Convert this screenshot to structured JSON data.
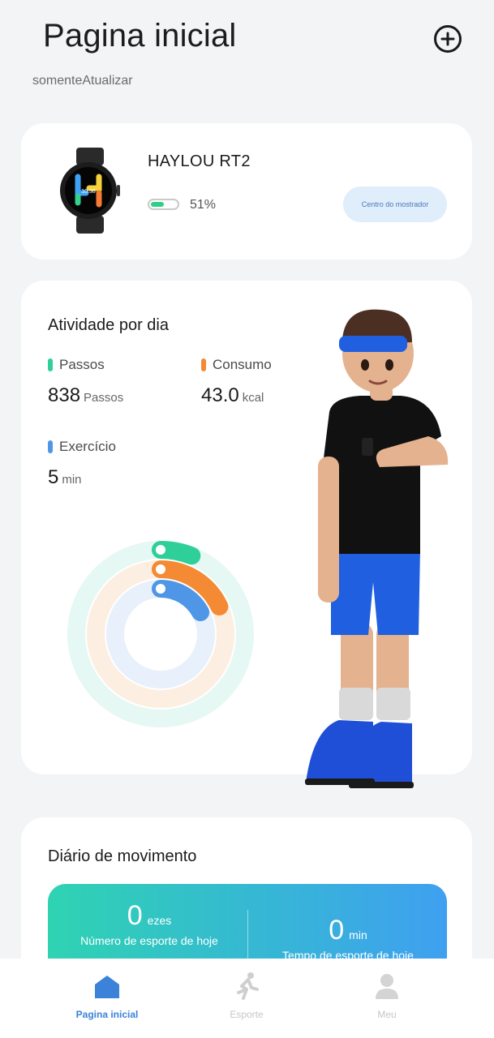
{
  "header": {
    "title": "Pagina inicial",
    "subtitle": "somenteAtualizar",
    "add_icon": "plus-circle-icon"
  },
  "device": {
    "name": "HAYLOU RT2",
    "battery_text": "51%",
    "battery_level": 0.51,
    "dial_button_label": "Centro do mostrador",
    "watch_time": "10:38"
  },
  "activity": {
    "title": "Atividade por dia",
    "steps": {
      "label": "Passos",
      "value": "838",
      "unit": "Passos",
      "color": "#2fcf9a"
    },
    "consumption": {
      "label": "Consumo",
      "value": "43.0",
      "unit": "kcal",
      "color": "#f48a33"
    },
    "exercise": {
      "label": "Exercício",
      "value": "5",
      "unit": "min",
      "color": "#4f97e6"
    },
    "rings": [
      {
        "name": "steps",
        "icon": "shoe-icon",
        "color": "#2fcf9a",
        "track": "#e6f8f3",
        "progress": 0.06
      },
      {
        "name": "consumption",
        "icon": "flame-icon",
        "color": "#f48a33",
        "track": "#fdeee2",
        "progress": 0.18
      },
      {
        "name": "exercise",
        "icon": "clock-icon",
        "color": "#4f97e6",
        "track": "#e7f0fb",
        "progress": 0.17
      }
    ]
  },
  "diary": {
    "title": "Diário de movimento",
    "sports_count": {
      "value": "0",
      "unit": "ezes",
      "label": "Número de esporte de hoje"
    },
    "sports_time": {
      "value": "0",
      "unit": "min",
      "label": "Tempo de esporte de hoje"
    }
  },
  "tabs": [
    {
      "label": "Pagina inicial",
      "icon": "home-icon",
      "active": true
    },
    {
      "label": "Esporte",
      "icon": "running-icon",
      "active": false
    },
    {
      "label": "Meu",
      "icon": "person-icon",
      "active": false
    }
  ]
}
